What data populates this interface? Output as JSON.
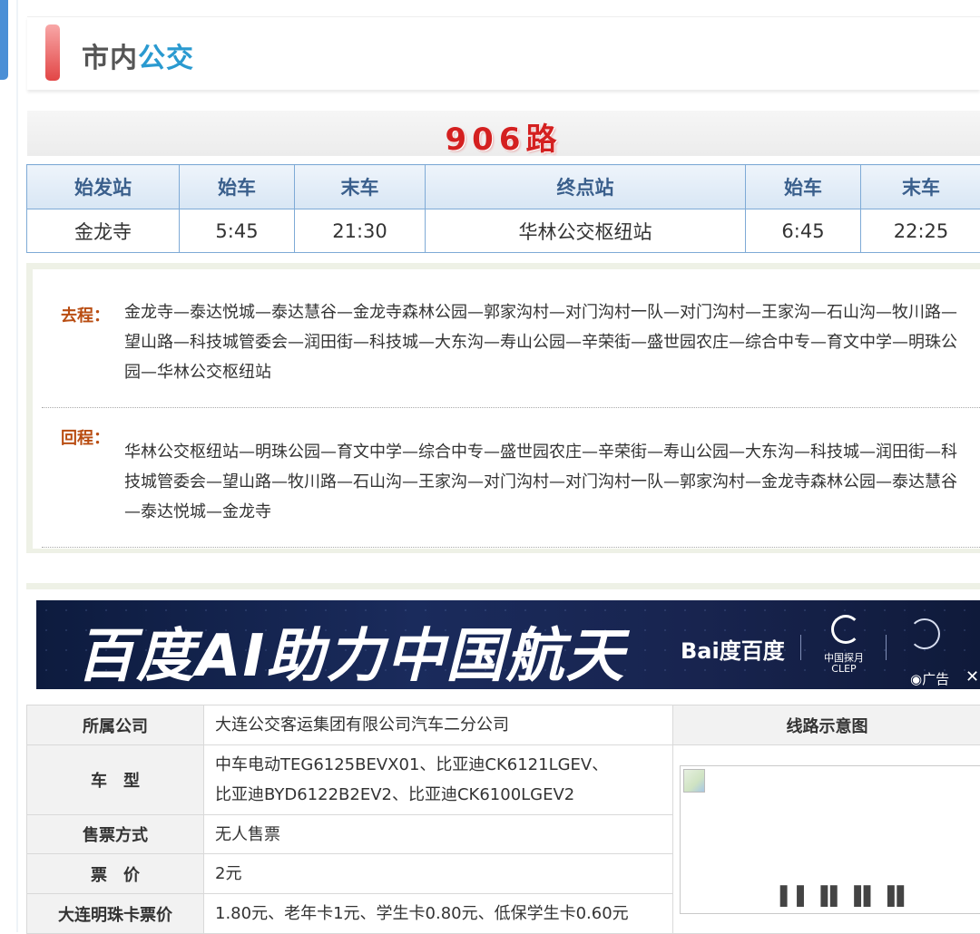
{
  "header": {
    "title_part1": "市内",
    "title_part2": "公交"
  },
  "route": {
    "name": "906路"
  },
  "schedule": {
    "headers": [
      "始发站",
      "始车",
      "末车",
      "终点站",
      "始车",
      "末车"
    ],
    "row": [
      "金龙寺",
      "5:45",
      "21:30",
      "华林公交枢纽站",
      "6:45",
      "22:25"
    ]
  },
  "stops": {
    "outbound_label": "去程：",
    "outbound": "金龙寺—泰达悦城—泰达慧谷—金龙寺森林公园—郭家沟村—对门沟村一队—对门沟村—王家沟—石山沟—牧川路—望山路—科技城管委会—润田街—科技城—大东沟—寿山公园—辛荣街—盛世园农庄—综合中专—育文中学—明珠公园—华林公交枢纽站",
    "return_label": "回程：",
    "return": "华林公交枢纽站—明珠公园—育文中学—综合中专—盛世园农庄—辛荣街—寿山公园—大东沟—科技城—润田街—科技城管委会—望山路—牧川路—石山沟—王家沟—对门沟村—对门沟村一队—郭家沟村—金龙寺森林公园—泰达慧谷—泰达悦城—金龙寺"
  },
  "ad": {
    "slogan": "百度AI助力中国航天",
    "brand": "Bai度百度",
    "clep_line1": "中国探月",
    "clep_line2": "CLEP",
    "badge": "广告",
    "close": "✕"
  },
  "info": {
    "company_label": "所属公司",
    "company": "大连公交客运集团有限公司汽车二分公司",
    "map_label": "线路示意图",
    "model_label": "车　型",
    "models_line1": "中车电动TEG6125BEVX01、比亚迪CK6121LGEV、",
    "models_line2": "比亚迪BYD6122B2EV2、比亚迪CK6100LGEV2",
    "ticket_label": "售票方式",
    "ticket": "无人售票",
    "price_label": "票　价",
    "price": "2元",
    "card_label": "大连明珠卡票价",
    "card_price": "1.80元、老年卡1元、学生卡0.80元、低保学生卡0.60元"
  }
}
